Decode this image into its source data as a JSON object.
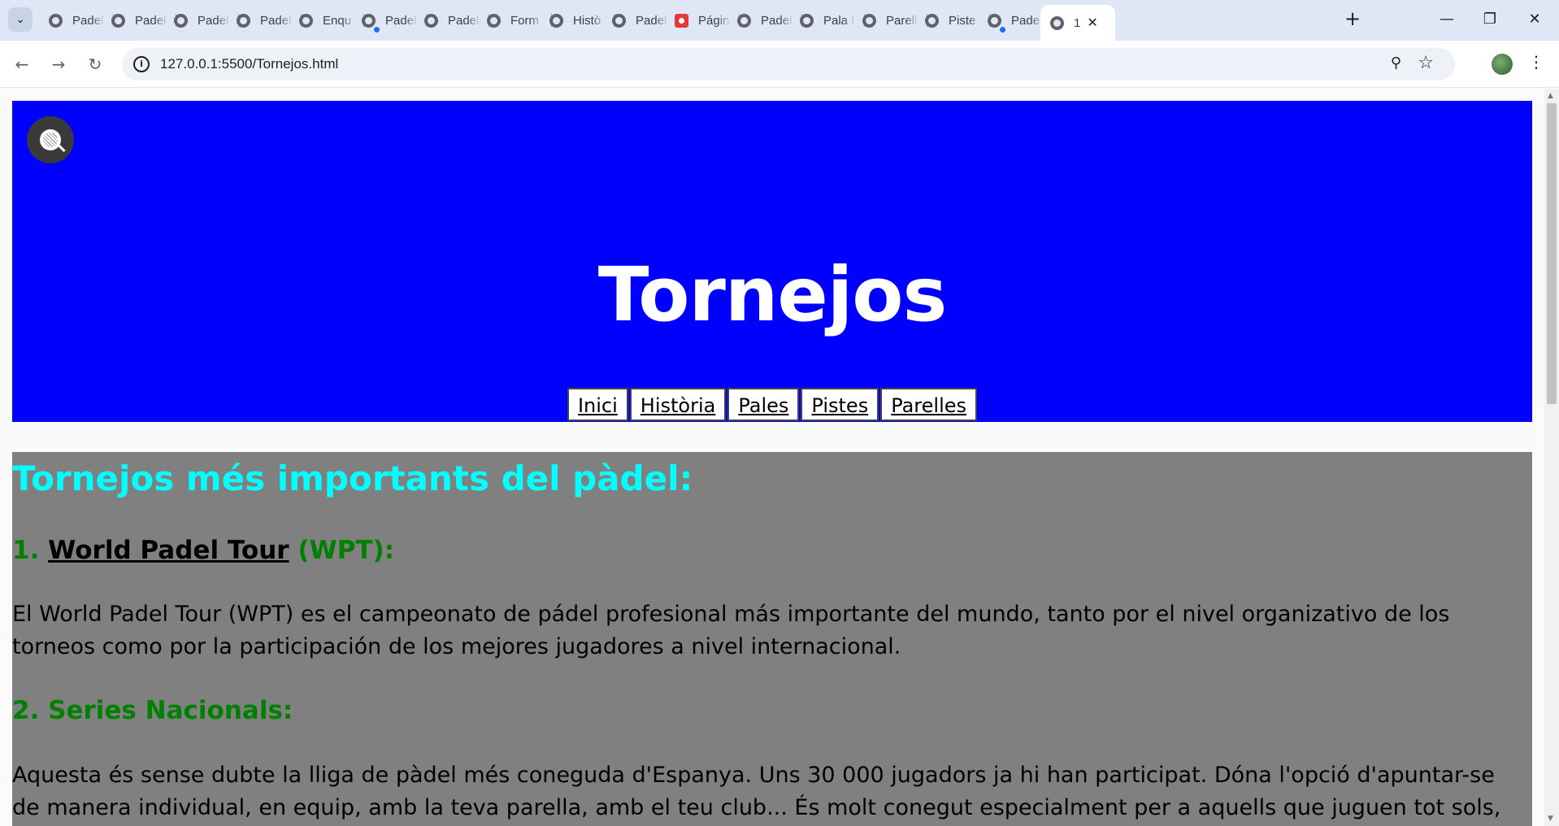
{
  "browser": {
    "tabs": [
      {
        "label": "Padel"
      },
      {
        "label": "Padel"
      },
      {
        "label": "Padel"
      },
      {
        "label": "Padel"
      },
      {
        "label": "Enqu"
      },
      {
        "label": "Padel"
      },
      {
        "label": "Padel"
      },
      {
        "label": "Form"
      },
      {
        "label": "Histò"
      },
      {
        "label": "Padel"
      },
      {
        "label": "Págin"
      },
      {
        "label": "Padel"
      },
      {
        "label": "Pala I"
      },
      {
        "label": "Parell"
      },
      {
        "label": "Piste"
      },
      {
        "label": "Padel"
      },
      {
        "label": "1"
      }
    ],
    "url": "127.0.0.1:5500/Tornejos.html"
  },
  "header": {
    "title": "Tornejos",
    "menu": [
      "Inici",
      "Història",
      "Pales",
      "Pistes",
      "Parelles"
    ]
  },
  "main": {
    "heading": "Tornejos més importants del pàdel:",
    "sections": [
      {
        "prefix": "1. ",
        "link": "World Padel Tour",
        "suffix": " (WPT):",
        "text": "El World Padel Tour (WPT) es el campeonato de pádel profesional más importante del mundo, tanto por el nivel organizativo de los torneos como por la participación de los mejores jugadores a nivel internacional."
      },
      {
        "title": "2. Series Nacionals:",
        "text": "Aquesta és sense dubte la lliga de pàdel més coneguda d'Espanya. Uns 30 000 jugadors ja hi han participat. Dóna l'opció d'apuntar-se de manera individual, en equip, amb la teva parella, amb el teu club... És molt conegut especialment per a aquells que juguen tot sols, ja que es"
      }
    ]
  },
  "colors": {
    "header_bg": "#0000ff",
    "content_bg": "#808080",
    "heading": "#00ffff",
    "subheading": "#008000"
  }
}
